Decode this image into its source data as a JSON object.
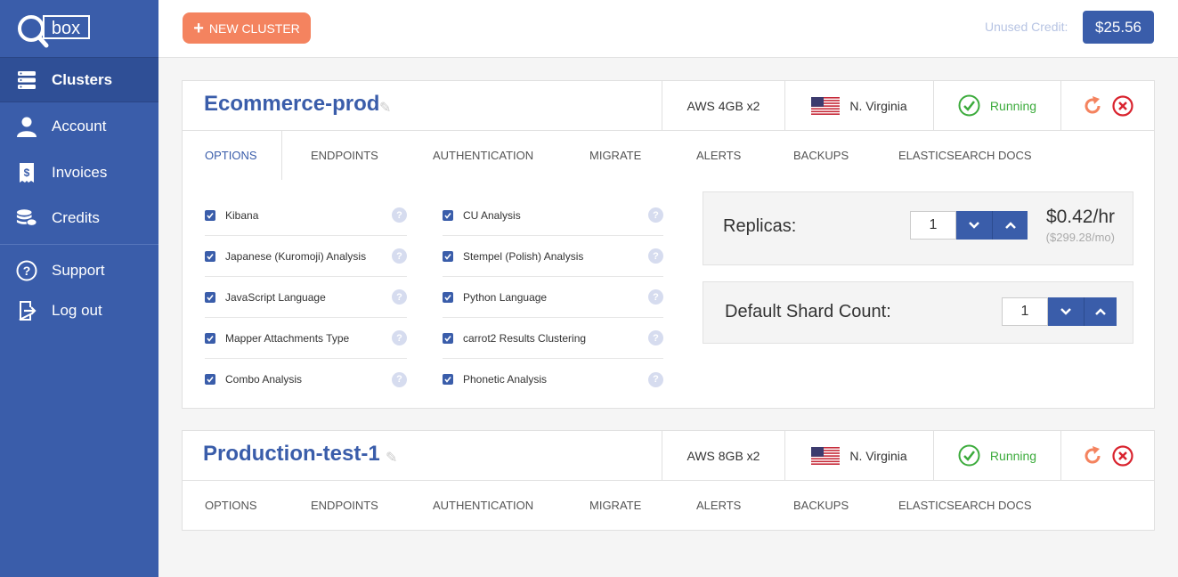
{
  "brand": {
    "logo_text": "box"
  },
  "sidebar": {
    "items": [
      {
        "label": "Clusters",
        "icon": "database-icon"
      },
      {
        "label": "Account",
        "icon": "user-icon"
      },
      {
        "label": "Invoices",
        "icon": "receipt-icon"
      },
      {
        "label": "Credits",
        "icon": "coins-icon"
      },
      {
        "label": "Support",
        "icon": "help-circle-icon"
      },
      {
        "label": "Log out",
        "icon": "logout-icon"
      }
    ]
  },
  "topbar": {
    "new_cluster_label": "NEW CLUSTER",
    "credit_label": "Unused Credit:",
    "credit_value": "$25.56"
  },
  "tab_labels": [
    "OPTIONS",
    "ENDPOINTS",
    "AUTHENTICATION",
    "MIGRATE",
    "ALERTS",
    "BACKUPS",
    "ELASTICSEARCH DOCS"
  ],
  "clusters": [
    {
      "name": "Ecommerce-prod",
      "instance": "AWS 4GB x2",
      "region": "N. Virginia",
      "status": "Running",
      "active_tab": "OPTIONS",
      "options_left": [
        "Kibana",
        "Japanese (Kuromoji) Analysis",
        "JavaScript Language",
        "Mapper Attachments Type",
        "Combo Analysis"
      ],
      "options_right": [
        "CU Analysis",
        "Stempel (Polish) Analysis",
        "Python Language",
        "carrot2 Results Clustering",
        "Phonetic Analysis"
      ],
      "replicas": {
        "label": "Replicas:",
        "value": "1",
        "price": "$0.42/hr",
        "price_monthly": "($299.28/mo)"
      },
      "shards": {
        "label": "Default Shard Count:",
        "value": "1"
      }
    },
    {
      "name": "Production-test-1",
      "instance": "AWS 8GB x2",
      "region": "N. Virginia",
      "status": "Running"
    }
  ],
  "colors": {
    "brand_blue": "#3a5daa",
    "accent_orange": "#f4835f",
    "running_green": "#3cab3c",
    "delete_red": "#d9232e"
  }
}
